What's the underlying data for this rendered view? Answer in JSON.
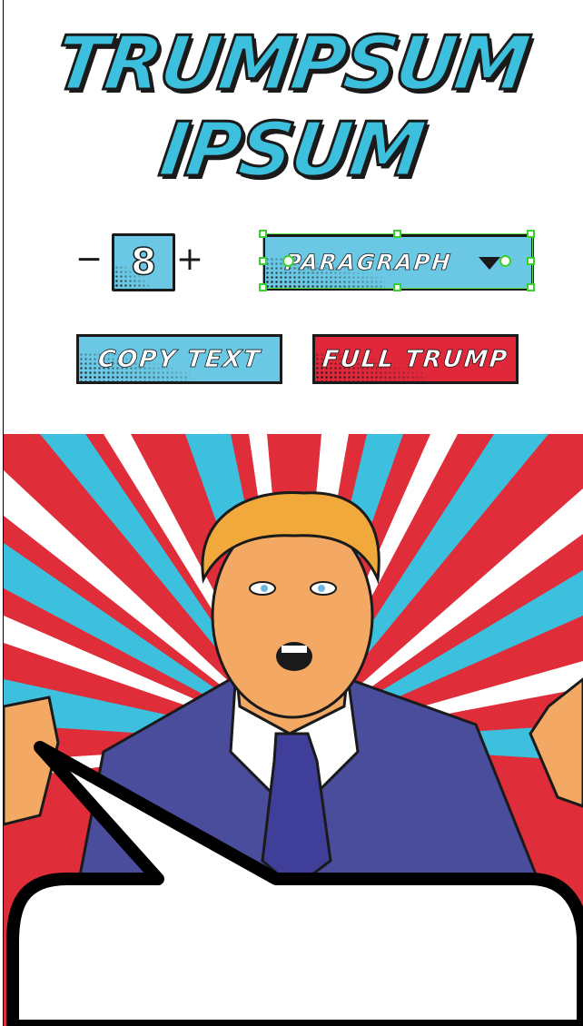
{
  "title": {
    "line1": "TRUMPSUM",
    "line2": "IPSUM"
  },
  "stepper": {
    "minus_label": "−",
    "plus_label": "+",
    "value": "8"
  },
  "select": {
    "selected": "PARAGRAPH"
  },
  "buttons": {
    "copy_label": "COPY TEXT",
    "full_label": "FULL TRUMP"
  },
  "colors": {
    "accent_blue": "#6bc8e4",
    "title_blue": "#3cc0de",
    "accent_red": "#e0283a",
    "ink": "#1a1a1a",
    "selection_green": "#3ad12e",
    "suit_blue": "#4a4c9c",
    "hair": "#f2a93b",
    "skin": "#f3a963"
  },
  "icons": {
    "minus": "minus-icon",
    "plus": "plus-icon",
    "caret": "chevron-down-icon"
  }
}
